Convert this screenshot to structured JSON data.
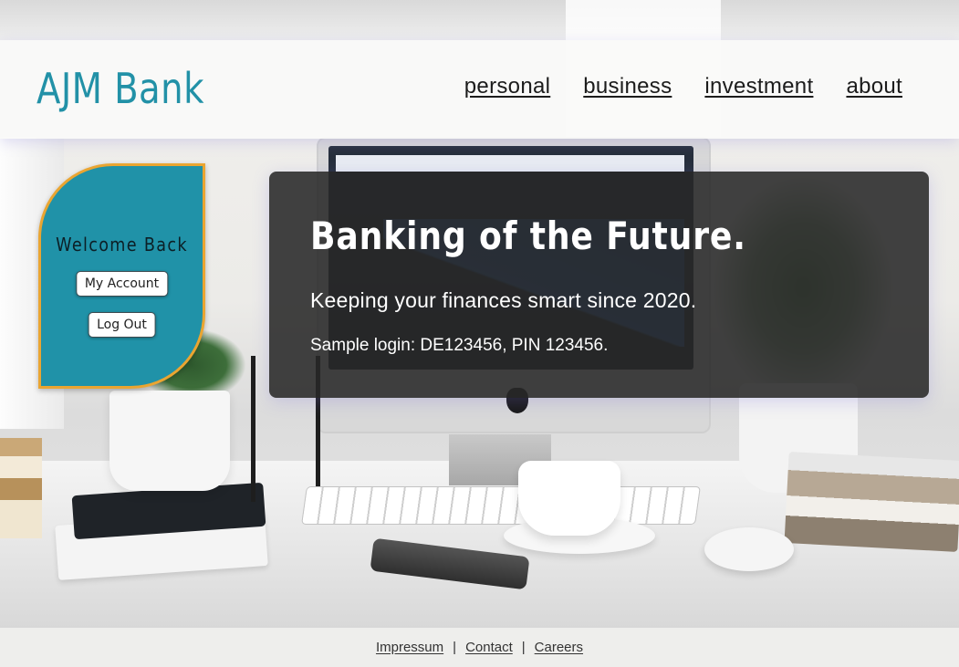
{
  "header": {
    "logo": "AJM Bank",
    "nav": [
      "personal",
      "business",
      "investment",
      "about"
    ]
  },
  "welcome": {
    "title": "Welcome Back",
    "my_account_label": "My Account",
    "logout_label": "Log Out"
  },
  "hero": {
    "title": "Banking of the Future.",
    "tagline": "Keeping your finances smart since 2020.",
    "sample_login": "Sample login: DE123456, PIN 123456."
  },
  "footer": {
    "links": [
      "Impressum",
      "Contact",
      "Careers"
    ],
    "separator": "|"
  },
  "colors": {
    "brand_teal": "#2092a8",
    "card_border_orange": "#eaa531",
    "hero_bg": "#282828"
  }
}
